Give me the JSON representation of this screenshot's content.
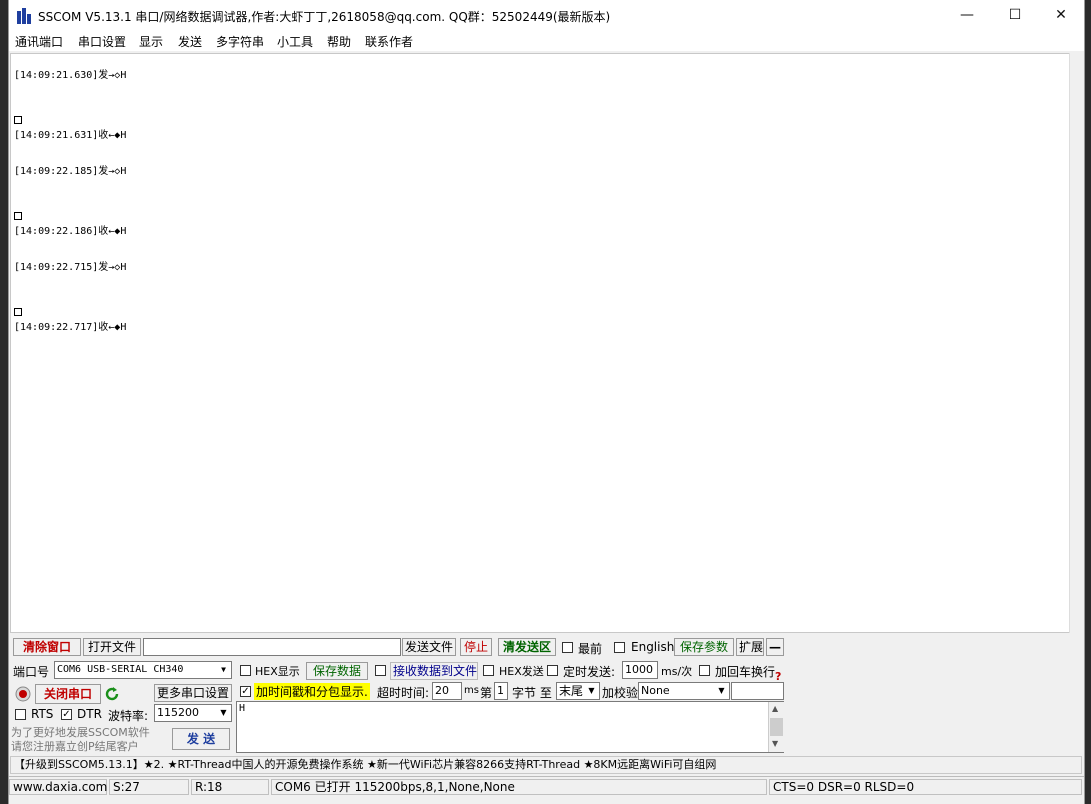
{
  "window": {
    "title": "SSCOM V5.13.1 串口/网络数据调试器,作者:大虾丁丁,2618058@qq.com. QQ群：52502449(最新版本)",
    "minimize": "—",
    "maximize": "☐",
    "close": "✕"
  },
  "menu": [
    "通讯端口",
    "串口设置",
    "显示",
    "发送",
    "多字符串",
    "小工具",
    "帮助",
    "联系作者"
  ],
  "log": [
    {
      "text": "[14:09:21.630]发→◇H",
      "sq": false
    },
    {
      "text": "[14:09:21.631]收←◆H",
      "sq": true
    },
    {
      "text": "[14:09:22.185]发→◇H",
      "sq": false
    },
    {
      "text": "[14:09:22.186]收←◆H",
      "sq": true
    },
    {
      "text": "[14:09:22.715]发→◇H",
      "sq": false
    },
    {
      "text": "[14:09:22.717]收←◆H",
      "sq": true
    }
  ],
  "toolbar": {
    "clear": "清除窗口",
    "open_file": "打开文件",
    "send_file": "发送文件",
    "stop": "停止",
    "clear_send": "清发送区",
    "topmost": "最前",
    "english": "English",
    "save_params": "保存参数",
    "expand": "扩展",
    "collapse": "—"
  },
  "port": {
    "label": "端口号",
    "value": "COM6 USB-SERIAL CH340",
    "close_button": "关闭串口",
    "more_settings": "更多串口设置",
    "rts": "RTS",
    "dtr": "DTR",
    "baud_label": "波特率:",
    "baud_value": "115200"
  },
  "options": {
    "hex_display": "HEX显示",
    "save_data": "保存数据",
    "recv_to_file": "接收数据到文件",
    "hex_send": "HEX发送",
    "timed_send": "定时发送:",
    "interval": "1000",
    "interval_unit": "ms/次",
    "add_crlf": "加回车换行",
    "timestamp": "加时间戳和分包显示.",
    "timeout_label": "超时时间:",
    "timeout_value": "20",
    "ms": "ms",
    "nth": "第",
    "byte_start": "1",
    "byte_label": "字节 至",
    "end_value": "末尾",
    "checksum_label": "加校验",
    "checksum_value": "None"
  },
  "send": {
    "content": "H",
    "button": "发 送",
    "promo": "为了更好地发展SSCOM软件\n请您注册嘉立创P结尾客户"
  },
  "ad": "【升级到SSCOM5.13.1】★2. ★RT-Thread中国人的开源免费操作系统 ★新一代WiFi芯片兼容8266支持RT-Thread ★8KM远距离WiFi可自组网",
  "status": {
    "site": "www.daxia.com",
    "sent": "S:27",
    "received": "R:18",
    "port_state": "COM6 已打开  115200bps,8,1,None,None",
    "lines": "CTS=0 DSR=0 RLSD=0"
  }
}
